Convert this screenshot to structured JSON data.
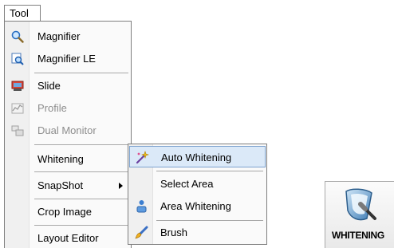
{
  "menubar": {
    "tool_label": "Tool"
  },
  "menu": {
    "items": [
      {
        "label": "Magnifier",
        "icon": "magnifier-icon"
      },
      {
        "label": "Magnifier LE",
        "icon": "magnifier-le-icon"
      },
      {
        "label": "Slide",
        "icon": "slide-icon"
      },
      {
        "label": "Profile",
        "icon": "profile-icon",
        "disabled": true
      },
      {
        "label": "Dual Monitor",
        "icon": "dual-monitor-icon",
        "disabled": true
      },
      {
        "label": "Whitening"
      },
      {
        "label": "SnapShot",
        "has_submenu": true
      },
      {
        "label": "Crop Image"
      },
      {
        "label": "Layout Editor"
      }
    ]
  },
  "submenu": {
    "items": [
      {
        "label": "Auto Whitening",
        "icon": "auto-whitening-icon",
        "highlighted": true
      },
      {
        "label": "Select Area"
      },
      {
        "label": "Area Whitening",
        "icon": "area-whitening-icon"
      },
      {
        "label": "Brush",
        "icon": "brush-icon"
      }
    ]
  },
  "whitening_button": {
    "label": "WHITENING",
    "icon": "whitening-tool-icon"
  },
  "colors": {
    "highlight_bg": "#dbe9f8",
    "highlight_border": "#7da2ce",
    "disabled_text": "#8d8d8d"
  }
}
